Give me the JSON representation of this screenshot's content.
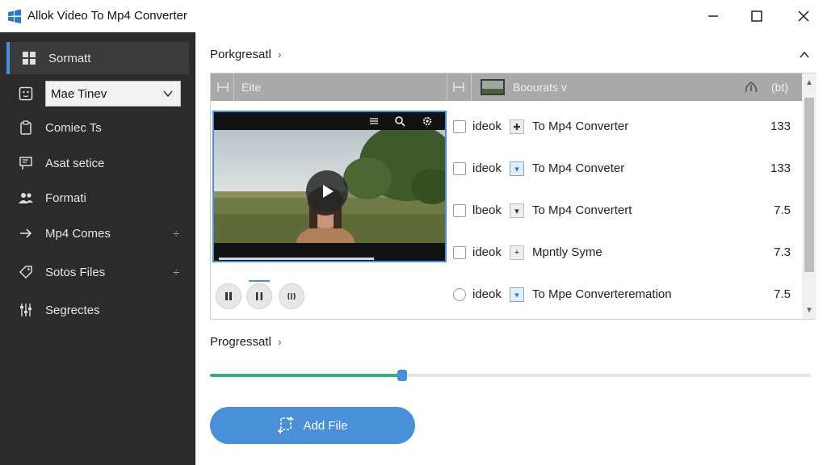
{
  "window": {
    "title": "Allok Video To Mp4 Converter",
    "icons": {
      "logo": "windows-logo-icon",
      "minimize": "minimize-icon",
      "maximize": "maximize-icon",
      "close": "close-icon"
    }
  },
  "sidebar": {
    "items": [
      {
        "label": "Sormatt",
        "icon": "grid-icon",
        "active": true
      },
      {
        "label": "Mae Tinev",
        "icon": "face-icon",
        "type": "select"
      },
      {
        "label": "Comiec Ts",
        "icon": "clipboard-icon"
      },
      {
        "label": "Asat setice",
        "icon": "presentation-icon"
      },
      {
        "label": "Formati",
        "icon": "people-icon"
      },
      {
        "label": "Mp4 Comes",
        "icon": "arrow-right-icon",
        "extra": "÷"
      },
      {
        "label": "Sotos Files",
        "icon": "tag-icon",
        "extra": "÷"
      },
      {
        "label": "Segrectes",
        "icon": "sliders-icon"
      }
    ]
  },
  "main": {
    "top_section": {
      "title": "Porkgresatl",
      "chevron": "›",
      "collapse_icon": "chevron-up-icon"
    },
    "file_panel": {
      "header": {
        "col1_label": "Eite",
        "col2_label": "Boourats",
        "col3_label": "(bt)",
        "col2_suffix": "v"
      },
      "rows": [
        {
          "source": "ideok",
          "icon_glyph": "✚",
          "target": "To Mp4 Converter",
          "size": "133",
          "checkbox": "square"
        },
        {
          "source": "ideok",
          "icon_glyph": "▾",
          "target": "To Mp4 Conveter",
          "size": "133",
          "checkbox": "square",
          "icon_blue": true
        },
        {
          "source": "lbeok",
          "icon_glyph": "▾",
          "target": "To Mp4 Convertert",
          "size": "7.5",
          "checkbox": "square"
        },
        {
          "source": "ideok",
          "icon_glyph": "+",
          "target": "Mpntly Syme",
          "size": "7.3",
          "checkbox": "square"
        },
        {
          "source": "ideok",
          "icon_glyph": "▾",
          "target": "To Mpe Converteremation",
          "size": "7.5",
          "checkbox": "round",
          "icon_blue": true
        }
      ],
      "video_preview": {
        "playback_progress": 0.7
      }
    },
    "progress_section": {
      "title": "Progressatl",
      "chevron": "›",
      "value": 0.32
    },
    "add_file_button": {
      "label": "Add File",
      "icon": "add-file-icon"
    }
  },
  "colors": {
    "accent": "#4a90d9",
    "progress": "#2fb37a",
    "sidebar": "#2b2b2b"
  }
}
